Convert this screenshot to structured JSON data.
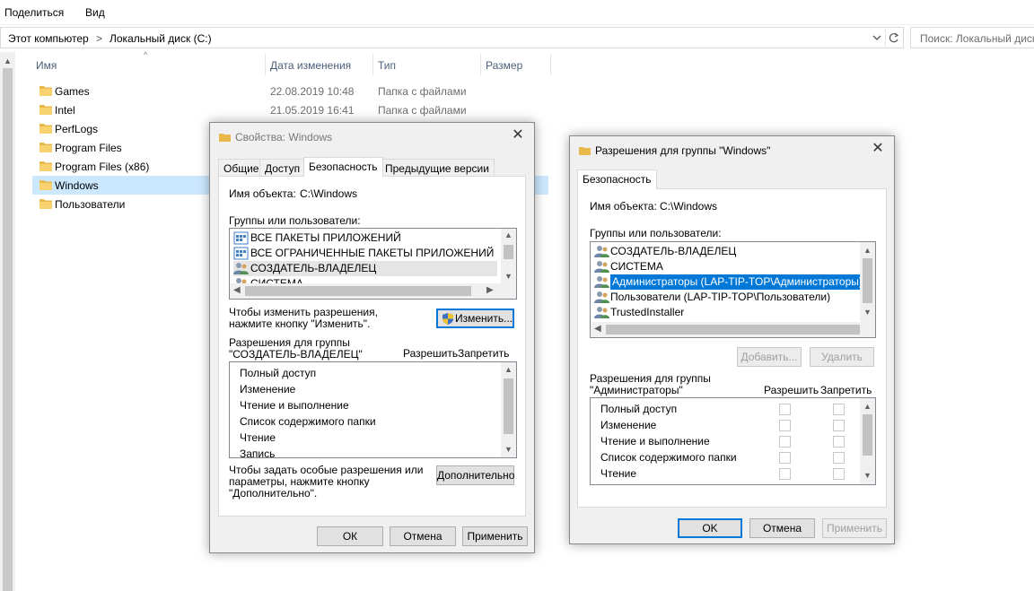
{
  "explorer": {
    "ribbon": {
      "share": "Поделиться",
      "view": "Вид"
    },
    "breadcrumb": {
      "computer": "Этот компьютер",
      "separator1": ">",
      "disk": "Локальный диск (C:)",
      "separator2": ">"
    },
    "search_placeholder": "Поиск: Локальный диск",
    "columns": {
      "name": "Имя",
      "date": "Дата изменения",
      "type": "Тип",
      "size": "Размер"
    },
    "files": [
      {
        "name": "Games",
        "date": "22.08.2019 10:48",
        "type": "Папка с файлами"
      },
      {
        "name": "Intel",
        "date": "21.05.2019 16:41",
        "type": "Папка с файлами"
      },
      {
        "name": "PerfLogs",
        "date": "",
        "type": ""
      },
      {
        "name": "Program Files",
        "date": "",
        "type": ""
      },
      {
        "name": "Program Files (x86)",
        "date": "",
        "type": ""
      },
      {
        "name": "Windows",
        "date": "",
        "type": ""
      },
      {
        "name": "Пользователи",
        "date": "",
        "type": ""
      }
    ],
    "folder_color": "#e8b84a"
  },
  "props": {
    "title": "Свойства: Windows",
    "tabs": [
      "Общие",
      "Доступ",
      "Безопасность",
      "Предыдущие версии"
    ],
    "object_label": "Имя объекта:",
    "object_value": "C:\\Windows",
    "groups_label": "Группы или пользователи:",
    "groups": [
      "ВСЕ ПАКЕТЫ ПРИЛОЖЕНИЙ",
      "ВСЕ ОГРАНИЧЕННЫЕ ПАКЕТЫ ПРИЛОЖЕНИЙ",
      "СОЗДАТЕЛЬ-ВЛАДЕЛЕЦ",
      "СИСТЕМА"
    ],
    "change_hint_1": "Чтобы изменить разрешения,",
    "change_hint_2": "нажмите кнопку \"Изменить\".",
    "change_button": "Изменить...",
    "perm_for_1": "Разрешения для группы",
    "perm_for_2": "\"СОЗДАТЕЛЬ-ВЛАДЕЛЕЦ\"",
    "allow": "Разрешить",
    "deny": "Запретить",
    "permissions": [
      "Полный доступ",
      "Изменение",
      "Чтение и выполнение",
      "Список содержимого папки",
      "Чтение",
      "Запись"
    ],
    "advanced_hint_1": "Чтобы задать особые разрешения или",
    "advanced_hint_2": "параметры, нажмите кнопку",
    "advanced_hint_3": "\"Дополнительно\".",
    "advanced_button": "Дополнительно",
    "ok": "ОК",
    "cancel": "Отмена",
    "apply": "Применить"
  },
  "perms": {
    "title": "Разрешения для группы \"Windows\"",
    "tab": "Безопасность",
    "object_label": "Имя объекта:",
    "object_value": "C:\\Windows",
    "groups_label": "Группы или пользователи:",
    "groups": [
      "СОЗДАТЕЛЬ-ВЛАДЕЛЕЦ",
      "СИСТЕМА",
      "Администраторы (LAP-TIP-TOP\\Администраторы)",
      "Пользователи (LAP-TIP-TOP\\Пользователи)",
      "TrustedInstaller"
    ],
    "add_button": "Добавить...",
    "remove_button": "Удалить",
    "perm_for_1": "Разрешения для группы",
    "perm_for_2": "\"Администраторы\"",
    "allow": "Разрешить",
    "deny": "Запретить",
    "permissions": [
      "Полный доступ",
      "Изменение",
      "Чтение и выполнение",
      "Список содержимого папки",
      "Чтение"
    ],
    "ok": "OK",
    "cancel": "Отмена",
    "apply": "Применить"
  },
  "colors": {
    "selection": "#0078d7",
    "row_selected": "#cce8ff",
    "header_text": "#4c607a"
  }
}
